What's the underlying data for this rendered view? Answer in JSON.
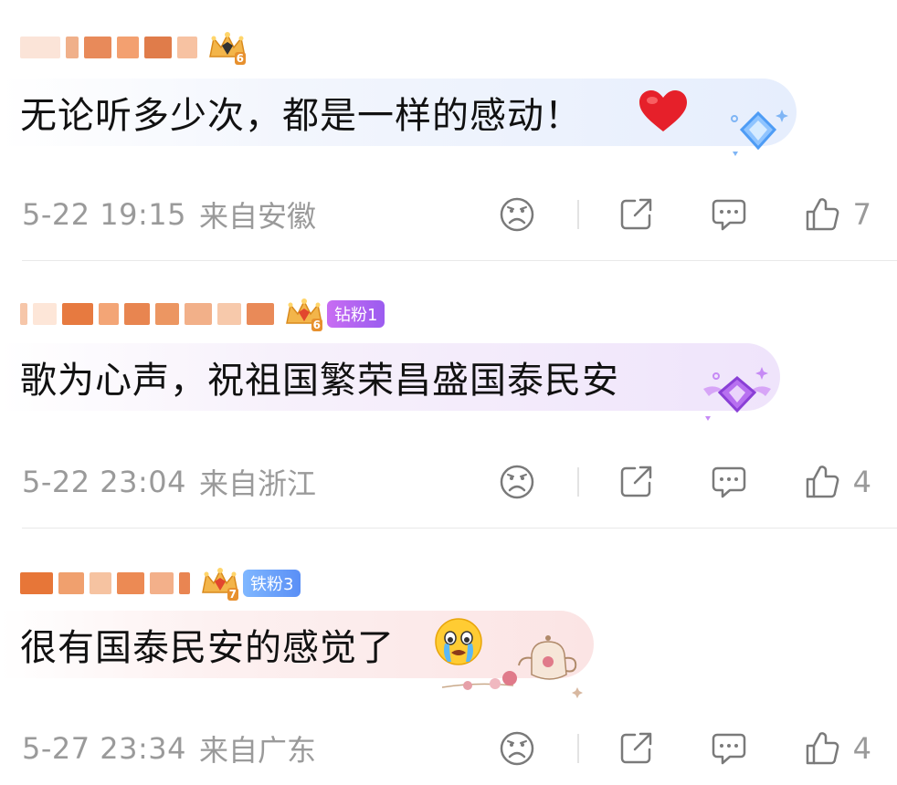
{
  "comments": [
    {
      "crown_level": "6",
      "fan_badge": "",
      "text": "无论听多少次，都是一样的感动！",
      "emoji": "red-heart",
      "deco": "blue-diamond",
      "time": "5-22 19:15",
      "location": "来自安徽",
      "likes": "7"
    },
    {
      "crown_level": "6",
      "fan_badge": "钻粉1",
      "text": "歌为心声，祝祖国繁荣昌盛国泰民安",
      "emoji": "",
      "deco": "purple-winged-diamond",
      "time": "5-22 23:04",
      "location": "来自浙江",
      "likes": "4"
    },
    {
      "crown_level": "7",
      "fan_badge": "铁粉3",
      "text": "很有国泰民安的感觉了",
      "emoji": "crying-face",
      "deco": "teapot-roses",
      "time": "5-27 23:34",
      "location": "来自广东",
      "likes": "4"
    }
  ],
  "icons": [
    "sad-face-icon",
    "share-icon",
    "comment-icon",
    "thumbs-up-icon"
  ],
  "colors": {
    "meta_text": "#9a9a9a",
    "badge_purple": "#b066f2",
    "badge_blue": "#6a9ef7",
    "heart": "#e6202a"
  }
}
